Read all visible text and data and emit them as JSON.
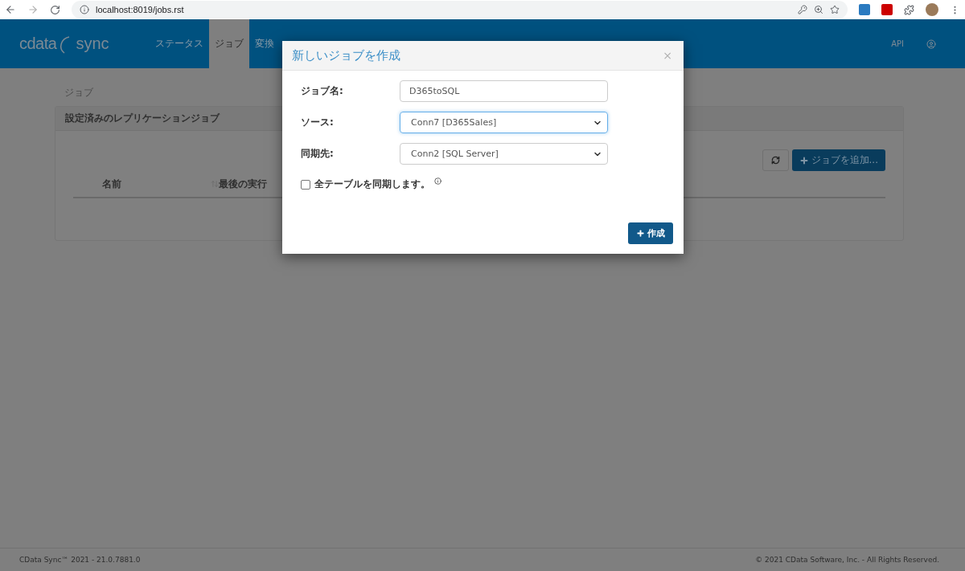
{
  "browser": {
    "url": "localhost:8019/jobs.rst"
  },
  "header": {
    "logo": {
      "brand": "cdata",
      "product": "sync"
    },
    "nav": [
      {
        "label": "ステータス",
        "selected": false
      },
      {
        "label": "ジョブ",
        "selected": true
      },
      {
        "label": "変換",
        "selected": false
      }
    ],
    "api": "API"
  },
  "page": {
    "breadcrumb": "ジョブ",
    "panel_title": "設定済みのレプリケーションジョブ",
    "add_button": "ジョブを追加...",
    "columns": [
      {
        "label": "名前",
        "sortable": true
      },
      {
        "label": "最後の実行",
        "sortable": false
      }
    ]
  },
  "modal": {
    "title": "新しいジョブを作成",
    "close": "×",
    "fields": [
      {
        "kind": "text",
        "label": "ジョブ名:",
        "value": "D365toSQL",
        "focused": false
      },
      {
        "kind": "select",
        "label": "ソース:",
        "value": "Conn7 [D365Sales]",
        "focused": true
      },
      {
        "kind": "select",
        "label": "同期先:",
        "value": "Conn2 [SQL Server]",
        "focused": false
      }
    ],
    "checkbox": {
      "label": "全テーブルを同期します。",
      "checked": false
    },
    "submit": "作成"
  },
  "footer": {
    "left": "CData Sync™ 2021 - 21.0.7881.0",
    "right": "© 2021 CData Software, Inc. - All Rights Reserved."
  }
}
